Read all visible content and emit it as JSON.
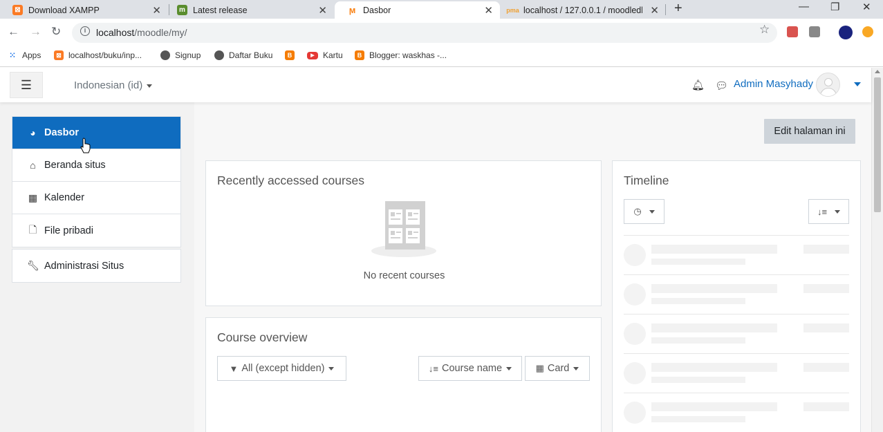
{
  "browser": {
    "tabs": [
      {
        "title": "Download XAMPP",
        "icon": "xampp-icon",
        "color": "#fb7a24"
      },
      {
        "title": "Latest release",
        "icon": "moodle-m-icon",
        "color": "#5a8d2e"
      },
      {
        "title": "Dasbor",
        "icon": "moodle-hat-icon",
        "color": "#f98012",
        "active": true
      },
      {
        "title": "localhost / 127.0.0.1 / moodledb",
        "icon": "phpmyadmin-icon",
        "color": "#f0a030"
      }
    ],
    "url_host": "localhost",
    "url_path": "/moodle/my/",
    "bookmarks": [
      {
        "label": "Apps",
        "icon": "apps-grid-icon"
      },
      {
        "label": "localhost/buku/inp...",
        "icon": "xampp-icon"
      },
      {
        "label": "Signup",
        "icon": "globe-icon"
      },
      {
        "label": "Daftar Buku",
        "icon": "globe-icon"
      },
      {
        "label": "",
        "icon": "blogger-icon"
      },
      {
        "label": "Kartu",
        "icon": "youtube-icon"
      },
      {
        "label": "Blogger: waskhas -...",
        "icon": "blogger-icon"
      }
    ]
  },
  "navbar": {
    "language": "Indonesian (id)",
    "user_name": "Admin Masyhady",
    "accent": "#0f6cbf"
  },
  "sidebar": {
    "items": [
      {
        "label": "Dasbor",
        "icon": "dashboard-icon",
        "active": true
      },
      {
        "label": "Beranda situs",
        "icon": "home-icon"
      },
      {
        "label": "Kalender",
        "icon": "calendar-icon"
      },
      {
        "label": "File pribadi",
        "icon": "file-icon"
      }
    ],
    "admin_item": {
      "label": "Administrasi Situs",
      "icon": "wrench-icon"
    }
  },
  "main": {
    "edit_button": "Edit halaman ini",
    "recent_courses": {
      "title": "Recently accessed courses",
      "empty_text": "No recent courses"
    },
    "course_overview": {
      "title": "Course overview",
      "filter_label": "All (except hidden)",
      "sort_label": "Course name",
      "view_label": "Card"
    },
    "timeline": {
      "title": "Timeline"
    }
  }
}
